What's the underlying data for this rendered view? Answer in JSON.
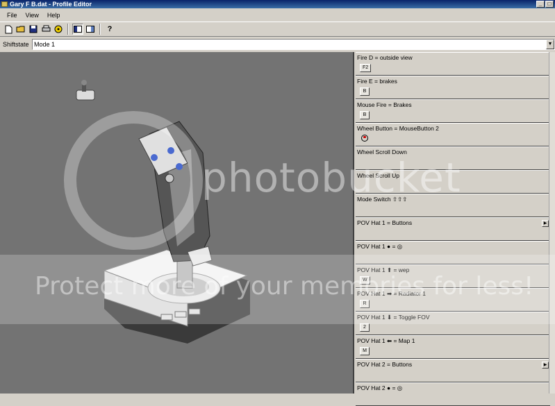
{
  "window": {
    "title": "Gary F B.dat - Profile Editor",
    "buttons": [
      "_",
      "□"
    ]
  },
  "menu": [
    "File",
    "View",
    "Help"
  ],
  "toolbar": {
    "icons": [
      "new-file-icon",
      "open-folder-icon",
      "save-icon",
      "print-icon",
      "radiation-icon",
      "layout-left-icon",
      "layout-right-icon",
      "help-icon"
    ]
  },
  "shiftstate": {
    "label": "Shiftstate",
    "value": "Mode 1"
  },
  "entries": [
    {
      "text": "Fire D = outside view",
      "key": "F2"
    },
    {
      "text": "Fire E = brakes",
      "key": "B"
    },
    {
      "text": "Mouse Fire = Brakes",
      "key": "B"
    },
    {
      "text": "Wheel Button = MouseButton 2",
      "key": ""
    },
    {
      "text": "Wheel Scroll Down",
      "key": ""
    },
    {
      "text": "Wheel Scroll Up",
      "key": ""
    },
    {
      "text": "Mode Switch ⇧⇧⇧",
      "key": ""
    },
    {
      "text": "POV Hat 1 = Buttons",
      "key": ""
    },
    {
      "text": "POV Hat 1 ● = ◎",
      "key": ""
    },
    {
      "text": "POV Hat 1 ⬆ = wep",
      "key": "W"
    },
    {
      "text": "POV Hat 1 ➡ = Radiator 1",
      "key": "R"
    },
    {
      "text": "POV Hat 1 ⬇ = Toggle FOV",
      "key": "2"
    },
    {
      "text": "POV Hat 1 ⬅ = Map 1",
      "key": "M"
    },
    {
      "text": "POV Hat 2 = Buttons",
      "key": ""
    },
    {
      "text": "POV Hat 2 ● = ◎",
      "key": ""
    }
  ],
  "watermark": {
    "line1": "photobucket",
    "line2": "Protect more of your memories for less!"
  }
}
